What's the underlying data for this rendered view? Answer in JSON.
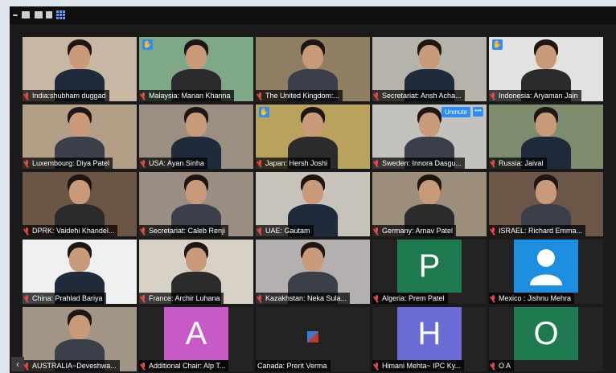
{
  "tiles": [
    {
      "label": "India:shubham duggad",
      "bg": "#c7b7a3",
      "hand": false
    },
    {
      "label": "Malaysia: Manan Khanna",
      "bg": "#7fa886",
      "hand": true
    },
    {
      "label": "The United Kingdom:...",
      "bg": "#8f7f62",
      "hand": false
    },
    {
      "label": "Secretariat: Ansh Acha...",
      "bg": "#b6b3aa",
      "hand": false
    },
    {
      "label": "Indonesia: Aryaman Jain",
      "bg": "#e2e2e0",
      "hand": true
    },
    {
      "label": "Luxembourg: Diya Patel",
      "bg": "#b39f86",
      "hand": false
    },
    {
      "label": "USA: Ayan Sinha",
      "bg": "#9b8f82",
      "hand": false
    },
    {
      "label": "Japan: Hersh Joshi",
      "bg": "#b8a25c",
      "hand": true
    },
    {
      "label": "Sweden: Innora Dasgu...",
      "bg": "#c4c2bc",
      "hand": false
    },
    {
      "label": "Russia: Jaival",
      "bg": "#7d8c6c",
      "hand": false
    },
    {
      "label": "DPRK: Vaidehi Khandel...",
      "bg": "#6b5545",
      "hand": false
    },
    {
      "label": "Secretariat: Caleb Renji",
      "bg": "#9a8e82",
      "hand": false
    },
    {
      "label": "UAE: Gautam",
      "bg": "#c7c2ba",
      "hand": false
    },
    {
      "label": "Germany: Arnav Patel",
      "bg": "#9d8e7c",
      "hand": false
    },
    {
      "label": "ISRAEL: Richard Emma...",
      "bg": "#6b5748",
      "hand": false
    },
    {
      "label": "China: Prahlad Bariya",
      "bg": "#f0f0f0",
      "hand": false
    },
    {
      "label": "France: Archir Luhana",
      "bg": "#d8d2c6",
      "hand": false
    },
    {
      "label": "Kazakhstan: Neka Sula...",
      "bg": "#b5b0b0",
      "hand": false
    },
    {
      "label": "Algeria: Prem Patel",
      "bg": "#232323",
      "hand": false
    },
    {
      "label": "Mexico : Jishnu Mehra",
      "bg": "#232323",
      "hand": false
    },
    {
      "label": "AUSTRALIA~Deveshwa...",
      "bg": "#a39585",
      "hand": false
    },
    {
      "label": "Additional Chair: Alp T...",
      "bg": "#232323",
      "hand": false
    },
    {
      "label": "Canada: Prerit Verma",
      "bg": "#232323",
      "hand": false
    },
    {
      "label": "Himani Mehta~ IPC Ky...",
      "bg": "#232323",
      "hand": false
    },
    {
      "label": "O A",
      "bg": "#232323",
      "hand": false
    }
  ],
  "avatars": {
    "algeria": {
      "letter": "P",
      "color": "#1e7a4e"
    },
    "mexico": {
      "color": "#1d8fe0"
    },
    "alp": {
      "letter": "A",
      "color": "#c85ac8"
    },
    "himani": {
      "letter": "H",
      "color": "#6b6bd6"
    },
    "oa": {
      "letter": "O",
      "color": "#1e7a4e"
    }
  },
  "sweden_controls": {
    "unmute": "Unmute",
    "more": "•••"
  },
  "hand_glyph": "✋",
  "nav_arrow": "‹"
}
